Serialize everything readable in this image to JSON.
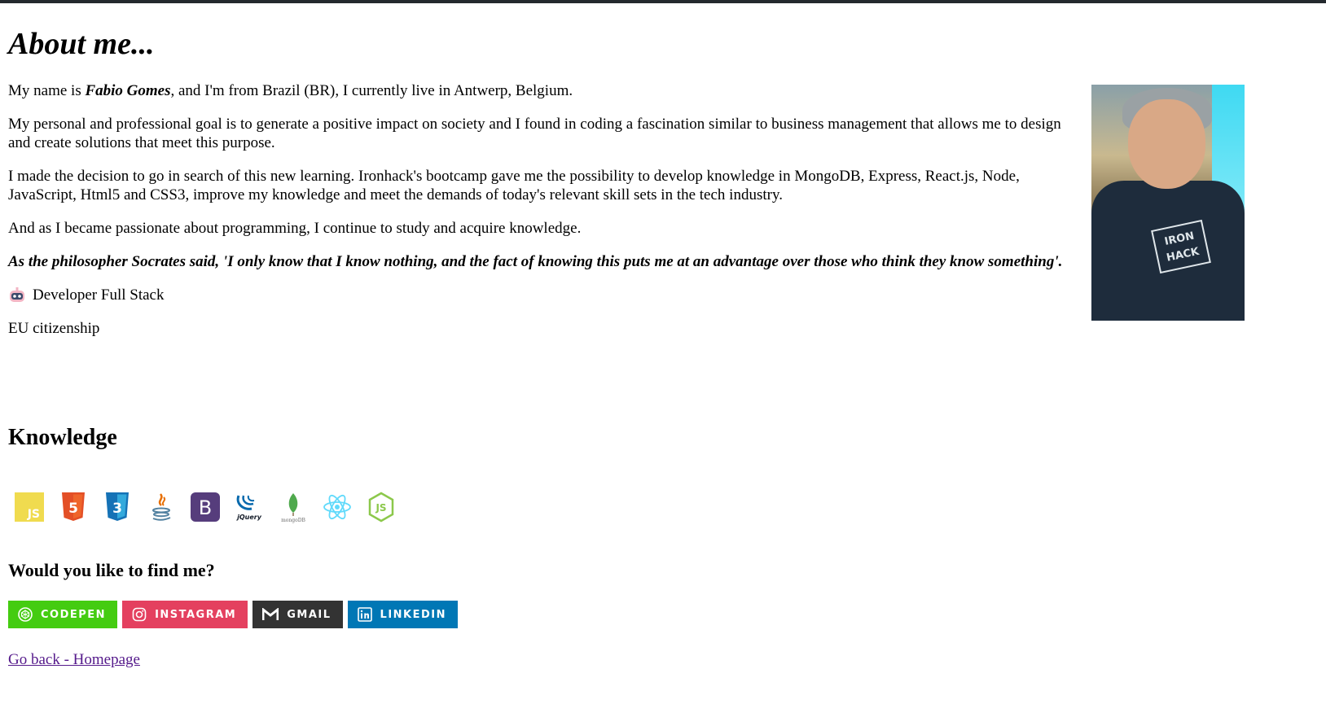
{
  "page": {
    "title": "About me..."
  },
  "bio": {
    "p1_prefix": "My name is ",
    "p1_name": "Fabio Gomes",
    "p1_suffix": ", and I'm from Brazil (BR), I currently live in Antwerp, Belgium.",
    "p2": "My personal and professional goal is to generate a positive impact on society and I found in coding a fascination similar to business management that allows me to design and create solutions that meet this purpose.",
    "p3": "I made the decision to go in search of this new learning. Ironhack's bootcamp gave me the possibility to develop knowledge in MongoDB, Express, React.js, Node, JavaScript, Html5 and CSS3, improve my knowledge and meet the demands of today's relevant skill sets in the tech industry.",
    "p4": "And as I became passionate about programming, I continue to study and acquire knowledge.",
    "quote": "As the philosopher Socrates said, 'I only know that I know nothing, and the fact of knowing this puts me at an advantage over those who think they know something'.",
    "role": "Developer Full Stack",
    "citizenship": "EU citizenship"
  },
  "photo": {
    "shirt_logo_line1": "IRON",
    "shirt_logo_line2": "HACK"
  },
  "knowledge": {
    "heading": "Knowledge",
    "skills": [
      {
        "icon": "javascript-icon",
        "text": "JS",
        "color": "#f0db4f"
      },
      {
        "icon": "html5-icon",
        "text": "5",
        "color": "#e34f26"
      },
      {
        "icon": "css3-icon",
        "text": "3",
        "color": "#1572b6"
      },
      {
        "icon": "java-icon",
        "color": "#5382a1"
      },
      {
        "icon": "bootstrap-icon",
        "text": "B",
        "color": "#563d7c"
      },
      {
        "icon": "jquery-icon",
        "text": "jQuery",
        "color": "#0769ad"
      },
      {
        "icon": "mongodb-icon",
        "text": "mongoDB",
        "color": "#4fa94d"
      },
      {
        "icon": "react-icon",
        "color": "#61dafb"
      },
      {
        "icon": "nodejs-icon",
        "text": "JS",
        "color": "#8cc84b"
      }
    ]
  },
  "find": {
    "heading": "Would you like to find me?",
    "badges": [
      {
        "label": "CODEPEN",
        "icon": "codepen-icon",
        "color": "#44cc11"
      },
      {
        "label": "INSTAGRAM",
        "icon": "instagram-icon",
        "color": "#e4405f"
      },
      {
        "label": "GMAIL",
        "icon": "gmail-icon",
        "color": "#333333"
      },
      {
        "label": "LINKEDIN",
        "icon": "linkedin-icon",
        "color": "#0077b5"
      }
    ]
  },
  "footer": {
    "back_link": "Go back - Homepage"
  }
}
